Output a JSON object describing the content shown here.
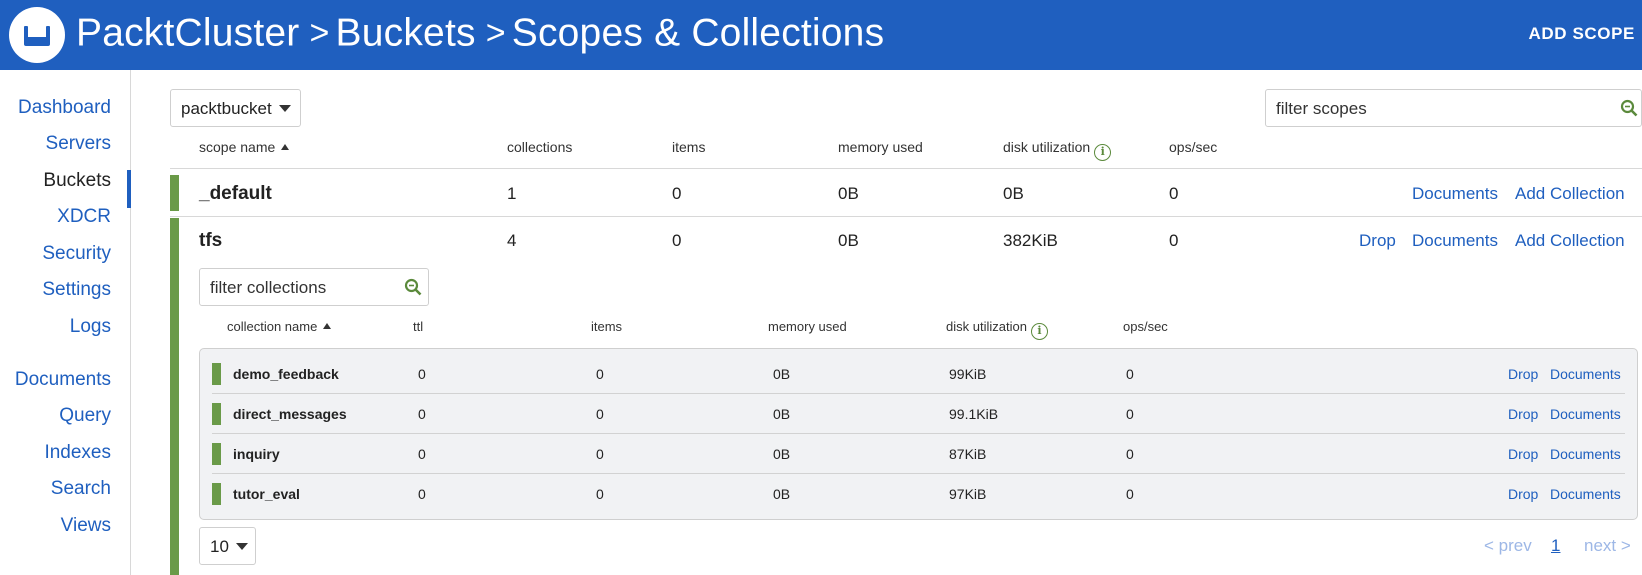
{
  "header": {
    "breadcrumb": [
      "PacktCluster",
      "Buckets",
      "Scopes & Collections"
    ],
    "separator": ">",
    "add_scope": "ADD SCOPE",
    "logo_icon": "couchbase-logo-icon",
    "colors": {
      "header_bg": "#1f5fbf",
      "accent_green": "#6a9a48",
      "link": "#1f5fbf"
    }
  },
  "sidebar": {
    "items": [
      {
        "label": "Dashboard"
      },
      {
        "label": "Servers"
      },
      {
        "label": "Buckets",
        "active": true
      },
      {
        "label": "XDCR"
      },
      {
        "label": "Security"
      },
      {
        "label": "Settings"
      },
      {
        "label": "Logs"
      },
      {
        "label": "Documents"
      },
      {
        "label": "Query"
      },
      {
        "label": "Indexes"
      },
      {
        "label": "Search"
      },
      {
        "label": "Views"
      }
    ]
  },
  "toolbar": {
    "bucket": "packtbucket",
    "filter_scopes_placeholder": "filter scopes"
  },
  "scope_table": {
    "headers": [
      "scope name",
      "collections",
      "items",
      "memory used",
      "disk utilization",
      "ops/sec"
    ],
    "rows": [
      {
        "name": "_default",
        "collections": "1",
        "items": "0",
        "memory": "0B",
        "disk": "0B",
        "ops": "0",
        "actions": [
          "Documents",
          "Add Collection"
        ]
      },
      {
        "name": "tfs",
        "collections": "4",
        "items": "0",
        "memory": "0B",
        "disk": "382KiB",
        "ops": "0",
        "actions": [
          "Drop",
          "Documents",
          "Add Collection"
        ]
      }
    ]
  },
  "collections": {
    "filter_placeholder": "filter collections",
    "headers": [
      "collection name",
      "ttl",
      "items",
      "memory used",
      "disk utilization",
      "ops/sec"
    ],
    "rows": [
      {
        "name": "demo_feedback",
        "ttl": "0",
        "items": "0",
        "memory": "0B",
        "disk": "99KiB",
        "ops": "0",
        "actions": [
          "Drop",
          "Documents"
        ]
      },
      {
        "name": "direct_messages",
        "ttl": "0",
        "items": "0",
        "memory": "0B",
        "disk": "99.1KiB",
        "ops": "0",
        "actions": [
          "Drop",
          "Documents"
        ]
      },
      {
        "name": "inquiry",
        "ttl": "0",
        "items": "0",
        "memory": "0B",
        "disk": "87KiB",
        "ops": "0",
        "actions": [
          "Drop",
          "Documents"
        ]
      },
      {
        "name": "tutor_eval",
        "ttl": "0",
        "items": "0",
        "memory": "0B",
        "disk": "97KiB",
        "ops": "0",
        "actions": [
          "Drop",
          "Documents"
        ]
      }
    ]
  },
  "pagination": {
    "page_size": "10",
    "prev": "< prev",
    "current": "1",
    "next": "next >"
  }
}
